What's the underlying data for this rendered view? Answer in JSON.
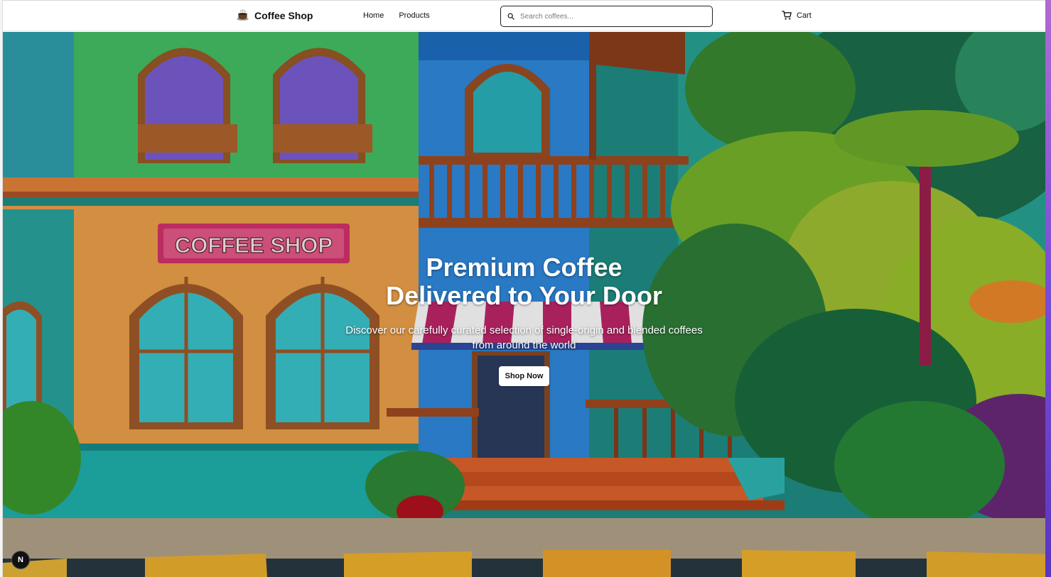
{
  "header": {
    "brand_icon": "coffee-cup-icon",
    "brand_name": "Coffee Shop",
    "nav": [
      {
        "label": "Home"
      },
      {
        "label": "Products"
      }
    ],
    "search": {
      "placeholder": "Search coffees...",
      "value": "",
      "icon": "search-icon"
    },
    "cart": {
      "label": "Cart",
      "icon": "shopping-cart-icon"
    }
  },
  "hero": {
    "title_line1": "Premium Coffee",
    "title_line2": "Delivered to Your Door",
    "subtitle": "Discover our carefully curated selection of single-origin and blended coffees from around the world",
    "cta_label": "Shop Now",
    "sign_text": "COFFEE SHOP"
  },
  "dev_badge": {
    "label": "N"
  },
  "colors": {
    "accent_text": "#111111",
    "hero_text": "#ffffff",
    "sign_pink": "#d6336e"
  }
}
